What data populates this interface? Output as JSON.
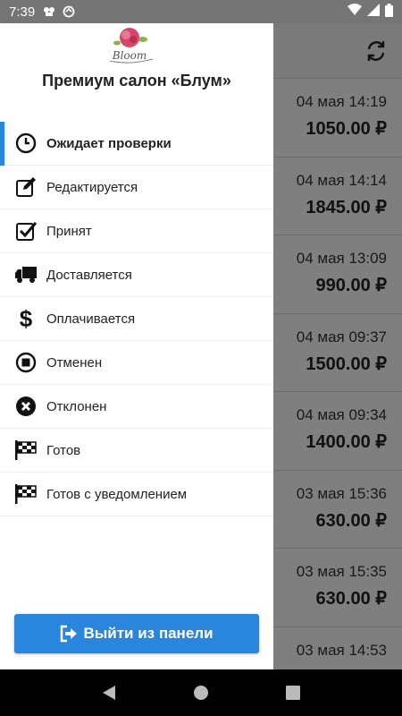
{
  "status_bar": {
    "time": "7:39"
  },
  "drawer": {
    "salon_name": "Премиум салон «Блум»",
    "logo_text": "Bloom",
    "menu": [
      {
        "label": "Ожидает проверки",
        "icon": "clock-icon",
        "active": true
      },
      {
        "label": "Редактируется",
        "icon": "edit-icon",
        "active": false
      },
      {
        "label": "Принят",
        "icon": "checkbox-icon",
        "active": false
      },
      {
        "label": "Доставляется",
        "icon": "truck-icon",
        "active": false
      },
      {
        "label": "Оплачивается",
        "icon": "dollar-icon",
        "active": false
      },
      {
        "label": "Отменен",
        "icon": "stop-circle-icon",
        "active": false
      },
      {
        "label": "Отклонен",
        "icon": "x-circle-icon",
        "active": false
      },
      {
        "label": "Готов",
        "icon": "checkered-flag-icon",
        "active": false
      },
      {
        "label": "Готов с уведомлением",
        "icon": "checkered-flag-icon",
        "active": false
      }
    ],
    "logout_label": "Выйти из панели"
  },
  "orders": [
    {
      "date": "04 мая 14:19",
      "price": "1050.00 ₽"
    },
    {
      "date": "04 мая 14:14",
      "price": "1845.00 ₽"
    },
    {
      "date": "04 мая 13:09",
      "price": "990.00 ₽"
    },
    {
      "date": "04 мая 09:37",
      "price": "1500.00 ₽"
    },
    {
      "date": "04 мая 09:34",
      "price": "1400.00 ₽"
    },
    {
      "date": "03 мая 15:36",
      "price": "630.00 ₽"
    },
    {
      "date": "03 мая 15:35",
      "price": "630.00 ₽"
    },
    {
      "date": "03 мая 14:53",
      "price": ""
    }
  ],
  "colors": {
    "accent": "#2a86dd",
    "scrim": "rgba(0,0,0,0.5)"
  }
}
